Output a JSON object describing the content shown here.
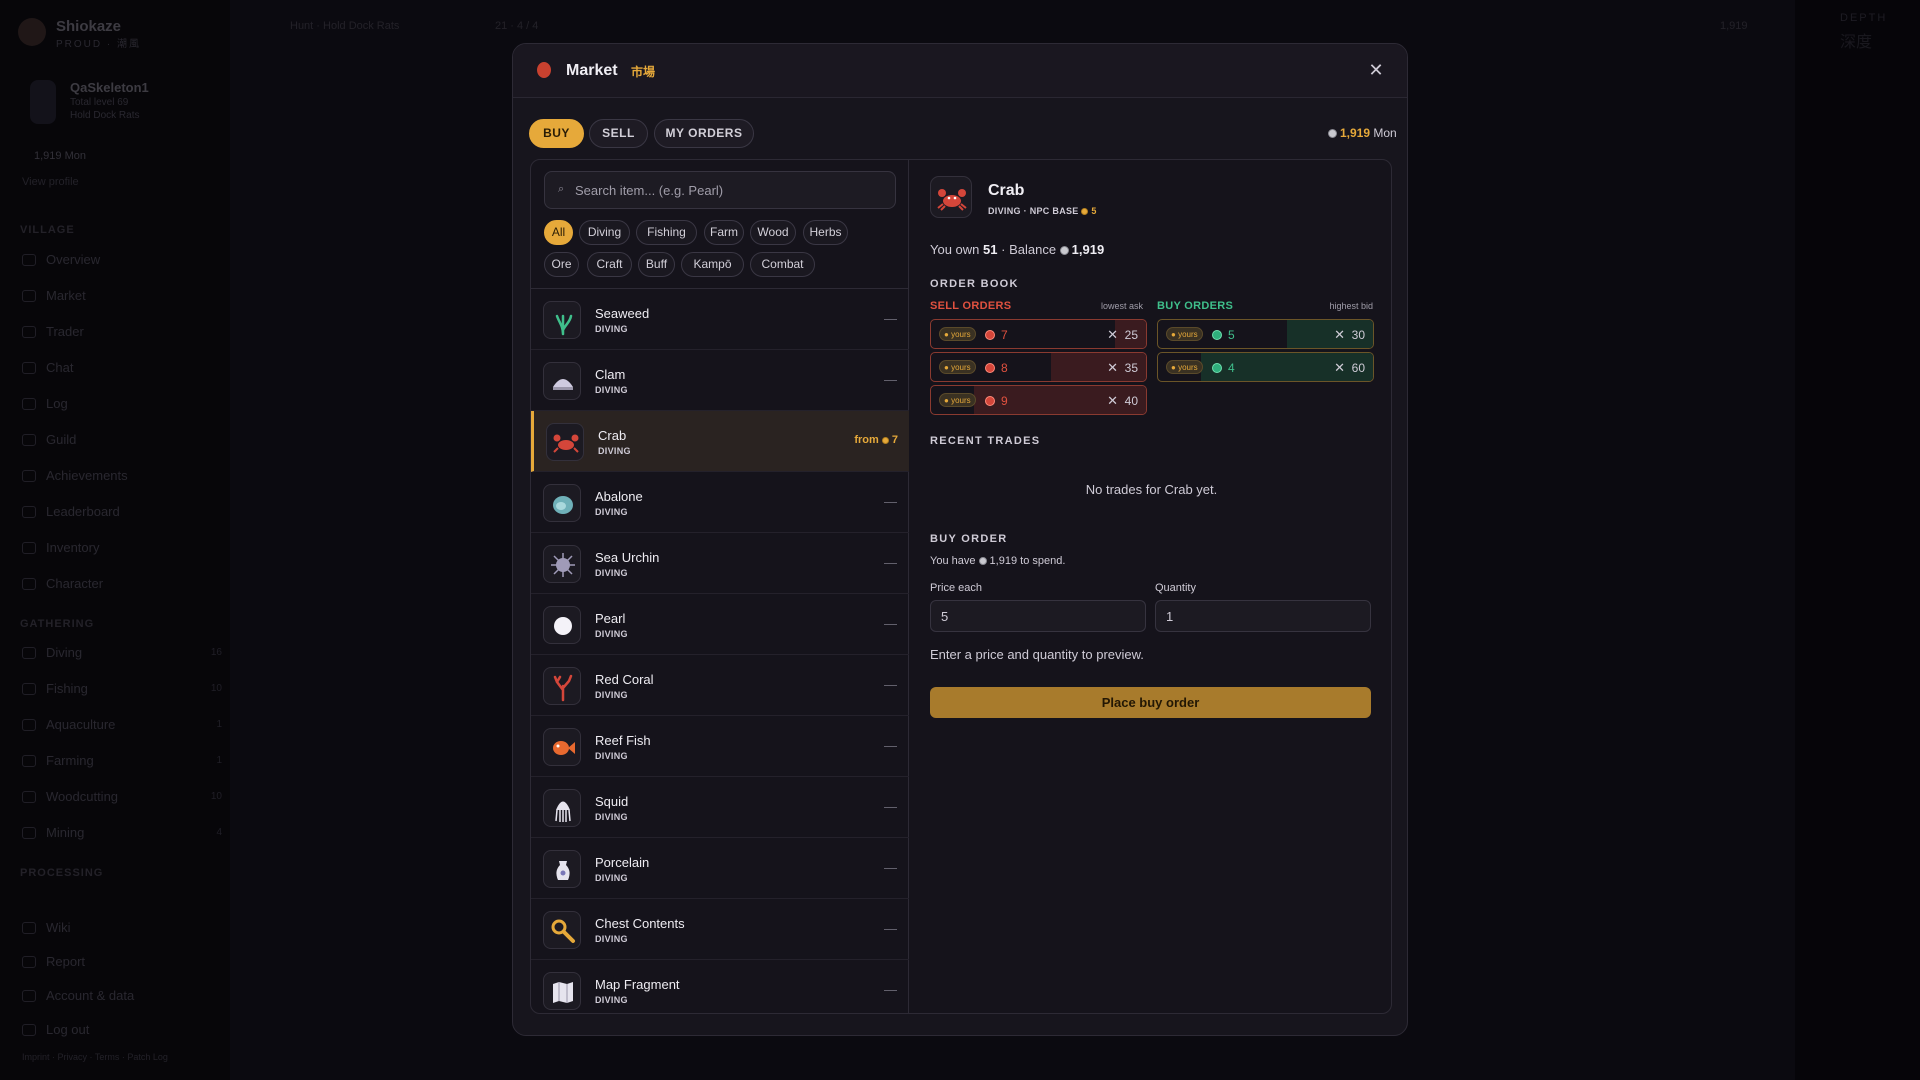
{
  "background": {
    "brand": {
      "name": "Shiokaze",
      "sub": "PROUD · 潮風"
    },
    "profile": {
      "name": "QaSkeleton1",
      "line1": "Total level 69",
      "line2": "Hold Dock Rats"
    },
    "balance": "1,919 Mon",
    "view_profile": "View profile",
    "sections": {
      "village": "VILLAGE",
      "gathering": "GATHERING",
      "processing": "PROCESSING"
    },
    "village_nav": [
      "Overview",
      "Market",
      "Trader",
      "Chat",
      "Log",
      "Guild",
      "Achievements",
      "Leaderboard",
      "Inventory",
      "Character"
    ],
    "gathering_nav": [
      {
        "label": "Diving",
        "count": "16"
      },
      {
        "label": "Fishing",
        "count": "10"
      },
      {
        "label": "Aquaculture",
        "count": "1"
      },
      {
        "label": "Farming",
        "count": "1"
      },
      {
        "label": "Woodcutting",
        "count": "10"
      },
      {
        "label": "Mining",
        "count": "4"
      }
    ],
    "bottom_nav": [
      "Wiki",
      "Report",
      "Account & data",
      "Log out"
    ],
    "footer": "Imprint · Privacy · Terms · Patch Log",
    "topbar": {
      "quest": "Hunt · Hold Dock Rats",
      "counter": "21 · 4 / 4",
      "top_balance": "1,919"
    },
    "rightpanel": {
      "depth": "DEPTH",
      "depth_jp": "深度"
    }
  },
  "modal": {
    "title": "Market",
    "title_jp": "市場",
    "close_icon": "close-icon",
    "tabs": [
      {
        "label": "BUY",
        "active": true
      },
      {
        "label": "SELL",
        "active": false
      },
      {
        "label": "MY ORDERS",
        "active": false
      }
    ],
    "balance": {
      "amount": "1,919",
      "unit": "Mon"
    },
    "search": {
      "placeholder": "Search item... (e.g. Pearl)",
      "value": ""
    },
    "filters": [
      "All",
      "Diving",
      "Fishing",
      "Farm",
      "Wood",
      "Herbs",
      "Ore",
      "Craft",
      "Buff",
      "Kampō",
      "Combat"
    ],
    "active_filter": "All",
    "items": [
      {
        "name": "Seaweed",
        "category": "DIVING",
        "price": "—",
        "icon": "seaweed-icon"
      },
      {
        "name": "Clam",
        "category": "DIVING",
        "price": "—",
        "icon": "clam-icon"
      },
      {
        "name": "Crab",
        "category": "DIVING",
        "price": "from",
        "from_value": "7",
        "icon": "crab-icon",
        "selected": true
      },
      {
        "name": "Abalone",
        "category": "DIVING",
        "price": "—",
        "icon": "abalone-icon"
      },
      {
        "name": "Sea Urchin",
        "category": "DIVING",
        "price": "—",
        "icon": "sea-urchin-icon"
      },
      {
        "name": "Pearl",
        "category": "DIVING",
        "price": "—",
        "icon": "pearl-icon"
      },
      {
        "name": "Red Coral",
        "category": "DIVING",
        "price": "—",
        "icon": "red-coral-icon"
      },
      {
        "name": "Reef Fish",
        "category": "DIVING",
        "price": "—",
        "icon": "reef-fish-icon"
      },
      {
        "name": "Squid",
        "category": "DIVING",
        "price": "—",
        "icon": "squid-icon"
      },
      {
        "name": "Porcelain",
        "category": "DIVING",
        "price": "—",
        "icon": "porcelain-icon"
      },
      {
        "name": "Chest Contents",
        "category": "DIVING",
        "price": "—",
        "icon": "magnifier-icon"
      },
      {
        "name": "Map Fragment",
        "category": "DIVING",
        "price": "—",
        "icon": "map-icon"
      }
    ],
    "detail": {
      "name": "Crab",
      "meta": "DIVING · NPC BASE",
      "npc_base": "5",
      "own_label": "You own",
      "own": "51",
      "balance_label": "· Balance",
      "balance": "1,919",
      "order_book": "ORDER BOOK",
      "sell_orders": "SELL ORDERS",
      "lowest_ask": "lowest ask",
      "buy_orders": "BUY ORDERS",
      "highest_bid": "highest bid",
      "yours": "yours",
      "sells": [
        {
          "price": "7",
          "qty": "25",
          "depth": 0.18
        },
        {
          "price": "8",
          "qty": "35",
          "depth": 0.55
        },
        {
          "price": "9",
          "qty": "40",
          "depth": 1.0
        }
      ],
      "buys": [
        {
          "price": "5",
          "qty": "30",
          "depth": 0.5
        },
        {
          "price": "4",
          "qty": "60",
          "depth": 1.0
        }
      ],
      "recent_trades": "RECENT TRADES",
      "no_trades": "No trades for Crab yet.",
      "buy_order": "BUY ORDER",
      "have_prefix": "You have",
      "have_amount": "1,919",
      "have_suffix": "to spend.",
      "price_label": "Price each",
      "price_value": "5",
      "qty_label": "Quantity",
      "qty_value": "1",
      "preview": "Enter a price and quantity to preview.",
      "place_button": "Place buy order"
    }
  }
}
